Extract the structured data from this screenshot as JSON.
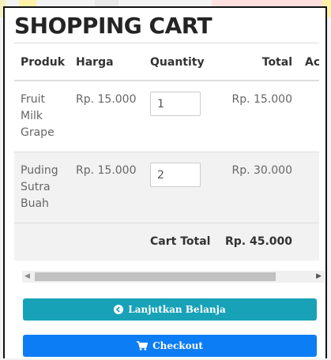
{
  "cart": {
    "title": "SHOPPING CART",
    "columns": [
      "Produk",
      "Harga",
      "Quantity",
      "Total",
      "Ac"
    ],
    "items": [
      {
        "name": "Fruit Milk Grape",
        "price": "Rp. 15.000",
        "quantity": "1",
        "total": "Rp. 15.000"
      },
      {
        "name": "Puding Sutra Buah",
        "price": "Rp. 15.000",
        "quantity": "2",
        "total": "Rp. 30.000"
      }
    ],
    "cart_total_label": "Cart Total",
    "cart_total_value": "Rp. 45.000"
  },
  "buttons": {
    "continue_label": "Lanjutkan Belanja",
    "continue_icon": "arrow-circle-left-icon",
    "checkout_label": "Checkout",
    "checkout_icon": "shopping-cart-icon"
  },
  "colors": {
    "continue_button": "#17a2b8",
    "checkout_button": "#0d7df5"
  }
}
